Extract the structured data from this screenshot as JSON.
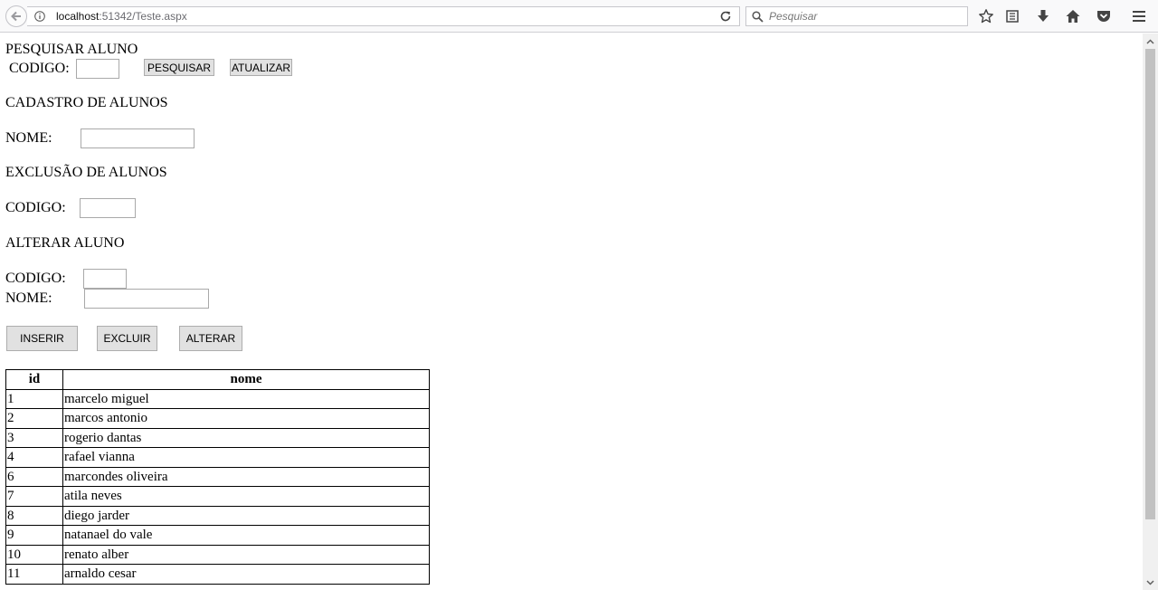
{
  "browser": {
    "url_host": "localhost",
    "url_rest": ":51342/Teste.aspx",
    "search_placeholder": "Pesquisar"
  },
  "pesquisar": {
    "heading": "PESQUISAR ALUNO",
    "codigo_label": "CODIGO:",
    "codigo_value": "",
    "pesquisar_button": "PESQUISAR",
    "atualizar_button": "ATUALIZAR"
  },
  "cadastro": {
    "heading": "CADASTRO DE ALUNOS",
    "nome_label": "NOME:",
    "nome_value": ""
  },
  "exclusao": {
    "heading": "EXCLUSÃO DE ALUNOS",
    "codigo_label": "CODIGO:",
    "codigo_value": ""
  },
  "alterar": {
    "heading": "ALTERAR ALUNO",
    "codigo_label": "CODIGO:",
    "codigo_value": "",
    "nome_label": "NOME:",
    "nome_value": ""
  },
  "actions": {
    "inserir": "INSERIR",
    "excluir": "EXCLUIR",
    "alterar": "ALTERAR"
  },
  "table": {
    "headers": [
      "id",
      "nome"
    ],
    "rows": [
      [
        "1",
        "marcelo miguel"
      ],
      [
        "2",
        "marcos antonio"
      ],
      [
        "3",
        "rogerio dantas"
      ],
      [
        "4",
        "rafael vianna"
      ],
      [
        "6",
        "marcondes oliveira"
      ],
      [
        "7",
        "atila neves"
      ],
      [
        "8",
        "diego jarder"
      ],
      [
        "9",
        "natanael do vale"
      ],
      [
        "10",
        "renato alber"
      ],
      [
        "11",
        "arnaldo cesar"
      ]
    ]
  }
}
